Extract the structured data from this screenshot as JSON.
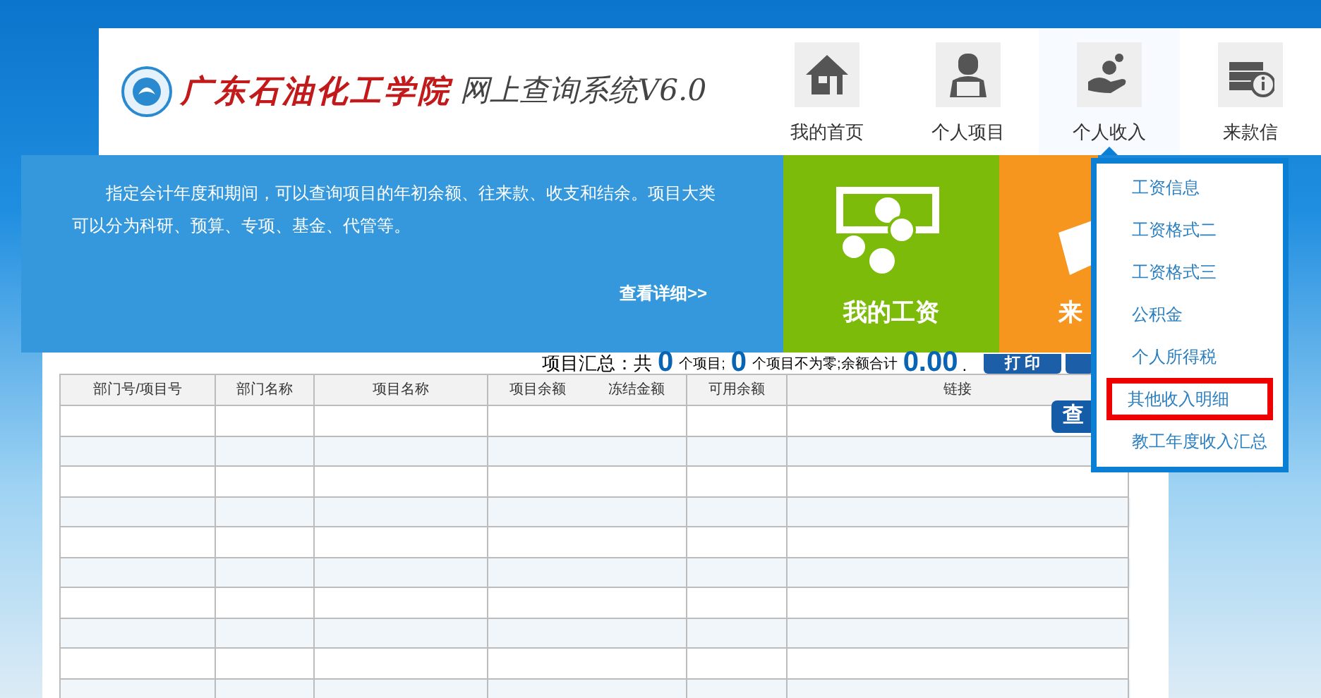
{
  "header": {
    "school_name": "广东石油化工学院",
    "system_title": "网上查询系统V6.0",
    "nav": [
      {
        "label": "我的首页",
        "kind": "home",
        "selected": false
      },
      {
        "label": "个人项目",
        "kind": "person",
        "selected": false
      },
      {
        "label": "个人收入",
        "kind": "income",
        "selected": true
      },
      {
        "label": "来款信",
        "kind": "money",
        "selected": false
      }
    ]
  },
  "banner": {
    "description": "指定会计年度和期间，可以查询项目的年初余额、往来款、收支和结余。项目大类可以分为科研、预算、专项、基金、代管等。",
    "details_link": "查看详细>>",
    "tiles": [
      {
        "label": "我的工资",
        "kind": "salary",
        "color": "#7dbb0a"
      },
      {
        "label": "来",
        "kind": "payment",
        "color": "#f7961e"
      }
    ]
  },
  "dropdown": {
    "items": [
      {
        "label": "工资信息",
        "selected": false
      },
      {
        "label": "工资格式二",
        "selected": false
      },
      {
        "label": "工资格式三",
        "selected": false
      },
      {
        "label": "公积金",
        "selected": false
      },
      {
        "label": "个人所得税",
        "selected": false
      },
      {
        "label": "其他收入明细",
        "selected": true
      },
      {
        "label": "教工年度收入汇总",
        "selected": false
      }
    ]
  },
  "summary": {
    "prefix": "项目汇总：共",
    "project_count": "0",
    "unit_1": "个项目;",
    "nonzero_count": "0",
    "unit_2": "个项目不为零;余额合计",
    "total": "0.00",
    "suffix": "."
  },
  "buttons": [
    "打 印"
  ],
  "table": {
    "columns": [
      [
        "部门号/项目号"
      ],
      [
        "部门名称"
      ],
      [
        "项目名称"
      ],
      [
        "项目余额",
        "冻结金额"
      ],
      [
        "可用余额"
      ],
      [
        "链接"
      ]
    ],
    "query_button": "查"
  }
}
